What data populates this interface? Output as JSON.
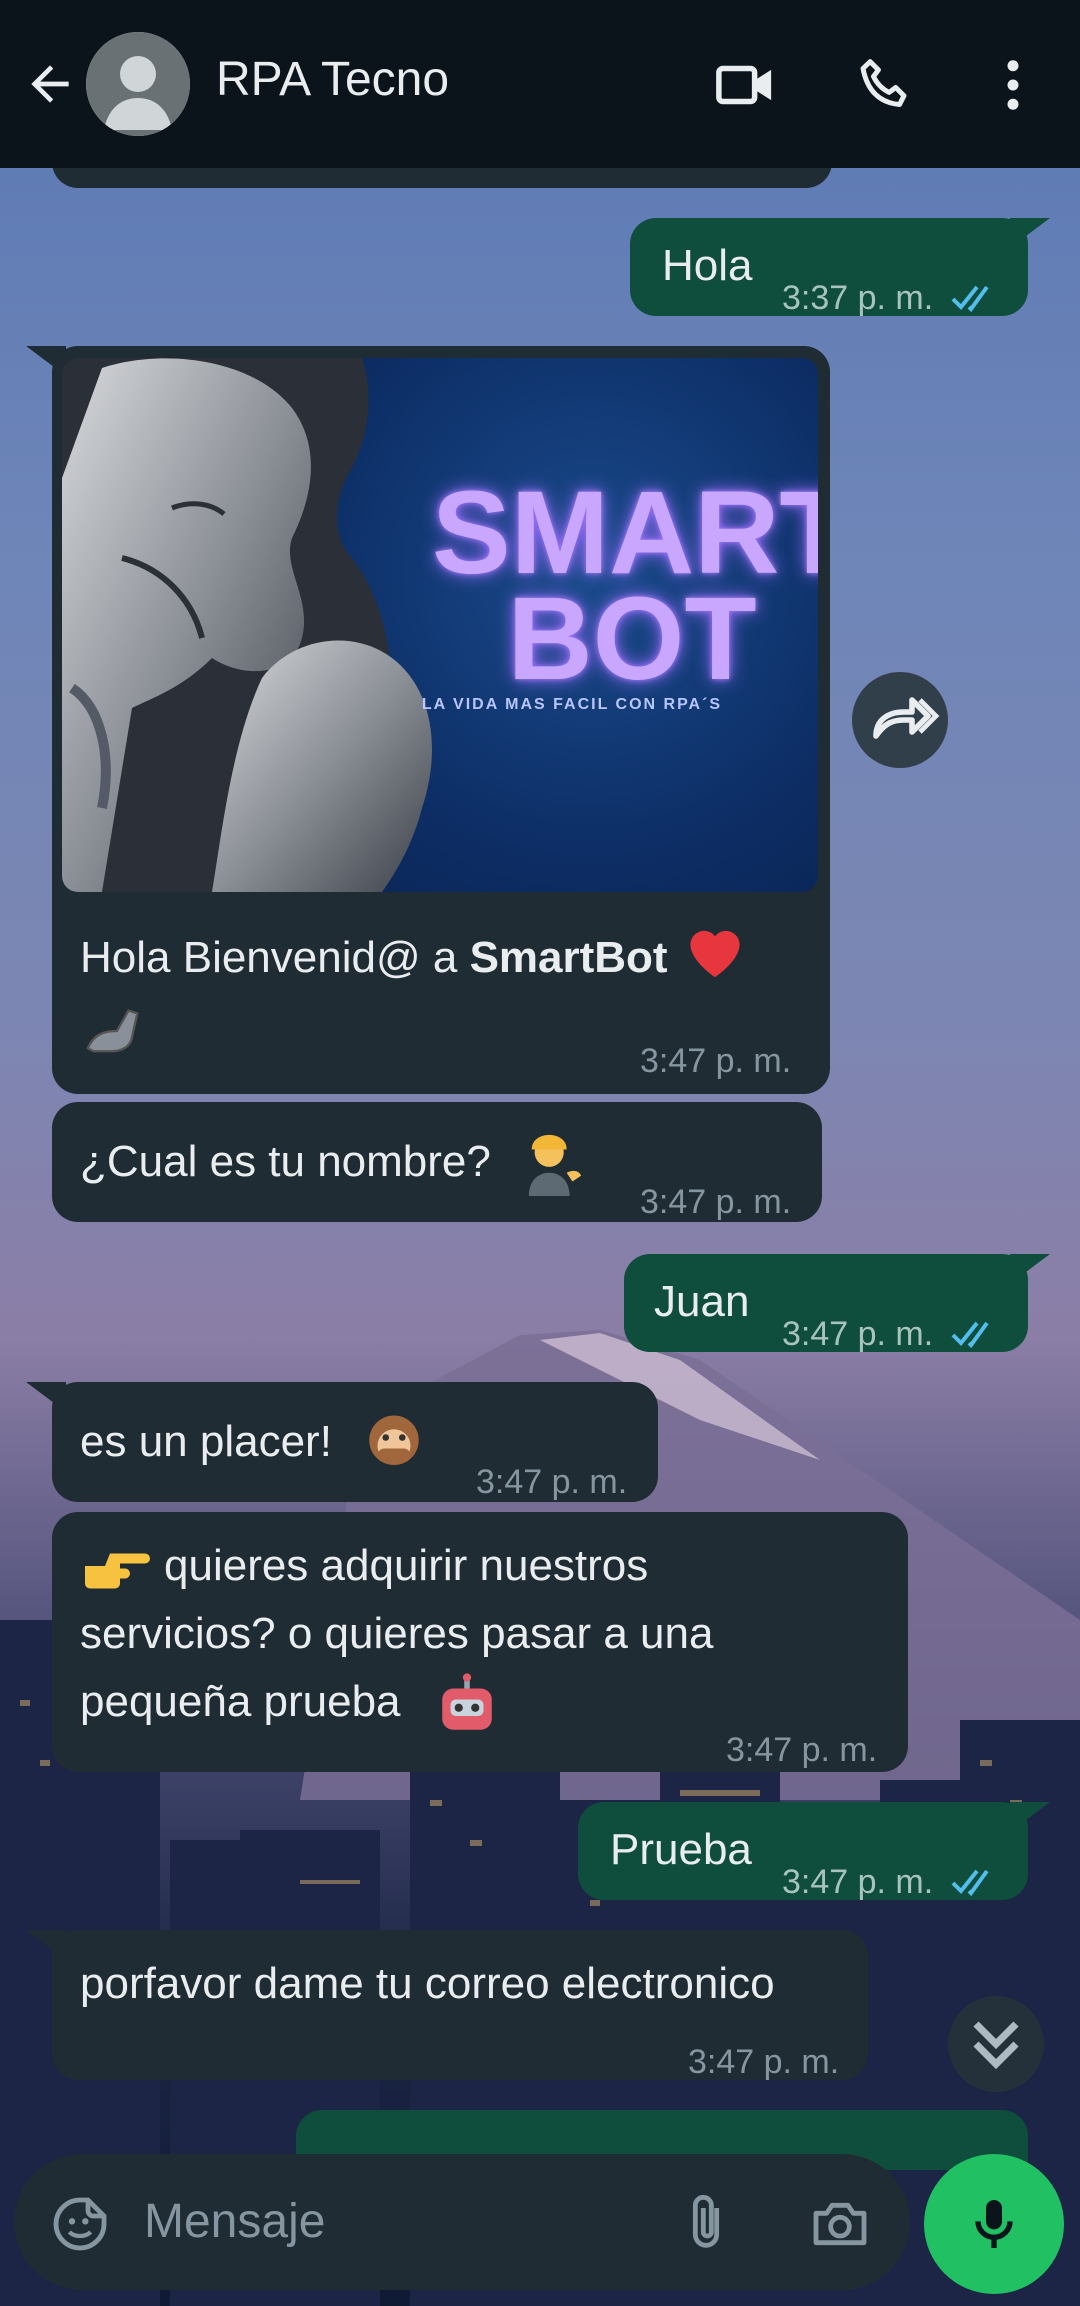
{
  "header": {
    "contact_name": "RPA Tecno",
    "icons": [
      "back-arrow-icon",
      "avatar-icon",
      "video-call-icon",
      "phone-icon",
      "more-vert-icon"
    ]
  },
  "messages": [
    {
      "direction": "out",
      "text": "Hola",
      "time": "3:37 p. m.",
      "read": true
    },
    {
      "direction": "in",
      "type": "image",
      "image_title_1": "SMART",
      "image_title_2": "BOT",
      "image_tagline": "LA VIDA MAS FACIL CON RPA´S",
      "text_prefix": "Hola Bienvenid@ a ",
      "text_bold": "SmartBot",
      "time": "3:47 p. m."
    },
    {
      "direction": "in",
      "text": "¿Cual es tu nombre?",
      "time": "3:47 p. m."
    },
    {
      "direction": "out",
      "text": "Juan",
      "time": "3:47 p. m.",
      "read": true
    },
    {
      "direction": "in",
      "text": "es un placer!",
      "time": "3:47 p. m."
    },
    {
      "direction": "in",
      "line1": "quieres adquirir nuestros",
      "line2": "servicios? o quieres pasar a una",
      "line3": "pequeña prueba",
      "time": "3:47 p. m."
    },
    {
      "direction": "out",
      "text": "Prueba",
      "time": "3:47 p. m.",
      "read": true
    },
    {
      "direction": "in",
      "text": "porfavor dame tu correo electronico",
      "time": "3:47 p. m."
    }
  ],
  "composer": {
    "placeholder": "Mensaje",
    "icons": [
      "emoji-sticker-icon",
      "attach-icon",
      "camera-icon",
      "mic-icon"
    ]
  },
  "colors": {
    "header_bg": "#0b141a",
    "incoming_bubble": "#202c33",
    "outgoing_bubble": "#0f4d3d",
    "read_ticks": "#53bdeb",
    "mic_button": "#21c063"
  }
}
